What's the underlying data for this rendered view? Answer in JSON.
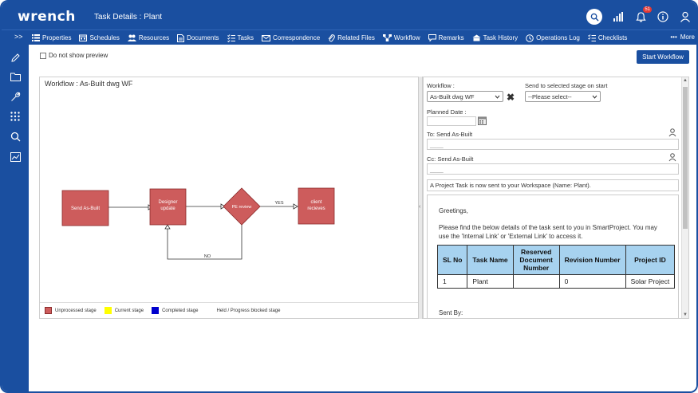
{
  "app": {
    "logo": "wrench",
    "page_title": "Task Details : Plant",
    "notification_count": "51"
  },
  "nav": {
    "toggle": ">>",
    "items": [
      {
        "label": "Properties",
        "icon": "list-icon"
      },
      {
        "label": "Schedules",
        "icon": "calendar-icon"
      },
      {
        "label": "Resources",
        "icon": "people-icon"
      },
      {
        "label": "Documents",
        "icon": "document-icon"
      },
      {
        "label": "Tasks",
        "icon": "tasks-icon"
      },
      {
        "label": "Correspondence",
        "icon": "mail-icon"
      },
      {
        "label": "Related Files",
        "icon": "paperclip-icon"
      },
      {
        "label": "Workflow",
        "icon": "workflow-icon"
      },
      {
        "label": "Remarks",
        "icon": "comment-icon"
      },
      {
        "label": "Task History",
        "icon": "history-icon"
      },
      {
        "label": "Operations Log",
        "icon": "log-icon"
      },
      {
        "label": "Checklists",
        "icon": "checklist-icon"
      }
    ],
    "more": "More"
  },
  "toolbar": {
    "preview_label": "Do not show preview",
    "start_button": "Start Workflow"
  },
  "workflow": {
    "title": "Workflow : As-Built dwg WF",
    "nodes": [
      "Send As-Built",
      "Designer update",
      "PE review",
      "client recieves"
    ],
    "edge_labels": {
      "yes": "YES",
      "no": "NO"
    },
    "legend": [
      "Unprocessed stage",
      "Current stage",
      "Completed stage",
      "Held / Progress blocked stage"
    ],
    "colors": {
      "unprocessed": "#cd5c5c",
      "current": "#ffff00",
      "completed": "#0000cd",
      "brand": "#1a4fa0"
    }
  },
  "form": {
    "workflow_label": "Workflow :",
    "workflow_value": "As-Built dwg WF",
    "send_stage_label": "Send to selected stage on start",
    "send_stage_value": "--Please select--",
    "planned_date_label": "Planned Date :",
    "planned_date_value": "",
    "to_label": "To: Send As-Built",
    "to_value": "____",
    "cc_label": "Cc: Send As-Built",
    "cc_value": "____",
    "subject": "A Project Task is now sent to your Workspace (Name: Plant)."
  },
  "email": {
    "greeting": "Greetings,",
    "body_line1": "Please find the below details of the task sent to you in SmartProject. You may",
    "body_line2": "use the 'Internal Link' or 'External Link' to access it.",
    "table": {
      "headers": [
        "SL No",
        "Task Name",
        "Reserved Document Number",
        "Revision Number",
        "Project ID"
      ],
      "rows": [
        [
          "1",
          "Plant",
          "",
          "0",
          "Solar Project"
        ]
      ]
    },
    "sent_by": "Sent By:"
  }
}
